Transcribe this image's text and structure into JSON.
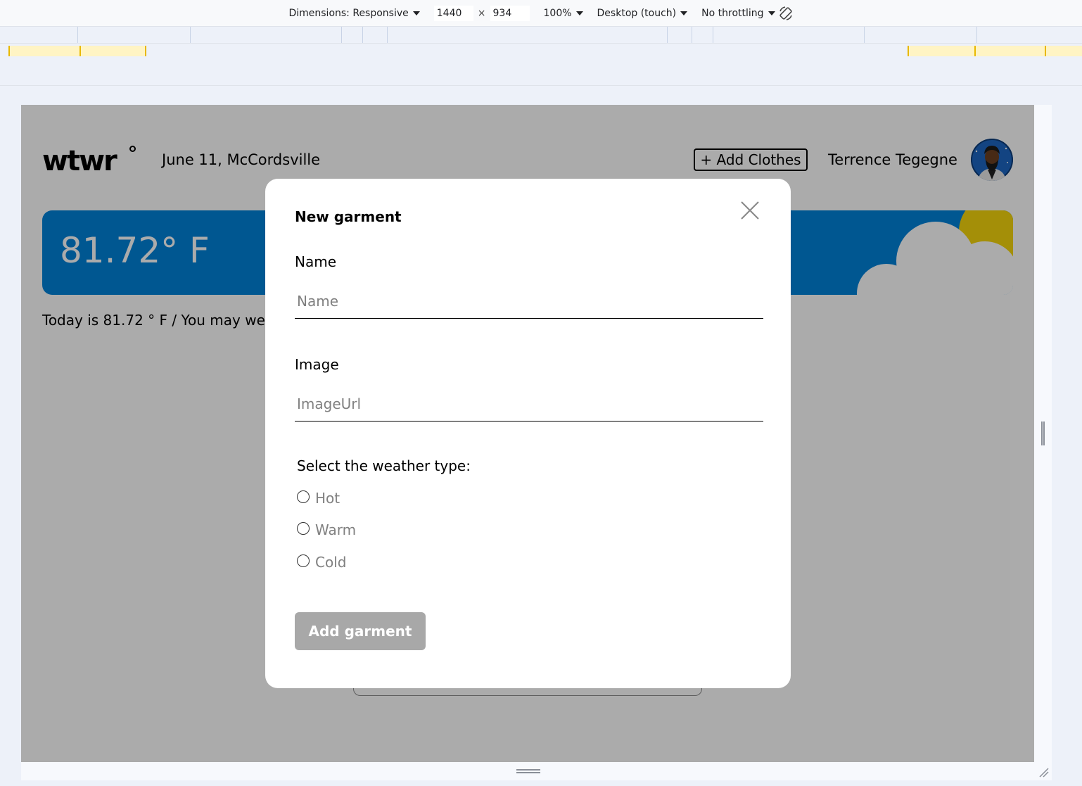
{
  "devtools": {
    "dimensions_label": "Dimensions: Responsive",
    "width_value": "1440",
    "times_symbol": "×",
    "height_value": "934",
    "zoom_label": "100%",
    "device_label": "Desktop (touch)",
    "throttling_label": "No throttling",
    "rotate_icon": "rotate-icon"
  },
  "header": {
    "logo": "wtwr",
    "date_location": "June 11, McCordsville",
    "add_clothes_label": "+ Add Clothes",
    "username": "Terrence Tegegne"
  },
  "weather": {
    "temperature": "81.72° F",
    "card_color": "#0082d9",
    "sun_color": "#f5d60d",
    "cloud_color": "#ffffff"
  },
  "main": {
    "today_text": "Today is 81.72 ° F / You may wear:"
  },
  "modal": {
    "title": "New garment",
    "name_label": "Name",
    "name_placeholder": "Name",
    "name_value": "",
    "image_label": "Image",
    "image_placeholder": "ImageUrl",
    "image_value": "",
    "weather_legend": "Select the weather type:",
    "options": [
      "Hot",
      "Warm",
      "Cold"
    ],
    "submit_label": "Add garment",
    "submit_color": "#a8a8a8"
  }
}
